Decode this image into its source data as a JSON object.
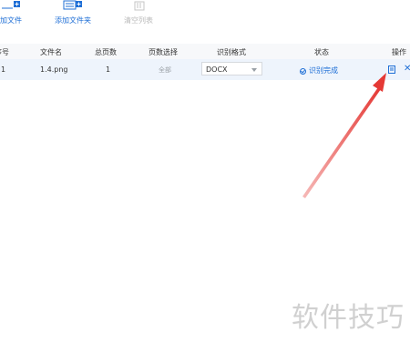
{
  "toolbar": {
    "add_file_label": "加文件",
    "add_folder_label": "添加文件夹",
    "clear_list_label": "清空列表"
  },
  "table": {
    "columns": [
      "序号",
      "文件名",
      "总页数",
      "页数选择",
      "识别格式",
      "状态",
      "操作"
    ],
    "rows": [
      {
        "index": "1",
        "filename": "1.4.png",
        "total_pages": "1",
        "page_selection": "全部",
        "format": "DOCX",
        "status": "识别完成"
      }
    ]
  },
  "icons": {
    "add_file": "file-plus-icon",
    "add_folder": "folder-plus-icon",
    "clear_list": "trash-icon",
    "status_check": "check-circle-icon",
    "open_document": "document-icon",
    "remove": "close-icon"
  },
  "colors": {
    "accent": "#1f6fd6",
    "annotation_arrow": "#e53935",
    "row_highlight": "#eef4fc"
  },
  "watermark": "软件技巧"
}
